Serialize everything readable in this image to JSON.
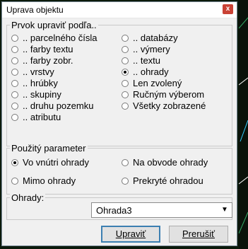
{
  "window": {
    "title": "Uprava objektu",
    "close_label": "x"
  },
  "group1": {
    "legend": "Prvok upraviť podľa..",
    "left_options": [
      ".. parcelného čísla",
      ".. farby textu",
      ".. farby zobr.",
      ".. vrstvy",
      ".. hrúbky",
      ".. skupiny",
      ".. druhu pozemku",
      ".. atributu"
    ],
    "right_options": [
      ".. databázy",
      ".. výmery",
      ".. textu",
      ".. ohrady",
      "Len zvolený",
      "Ručným výberom",
      "Všetky zobrazené"
    ],
    "selected": ".. ohrady"
  },
  "group2": {
    "legend": "Použitý parameter",
    "options": [
      "Vo vnútri ohrady",
      "Na obvode ohrady",
      "Mimo ohrady",
      "Prekryté ohradou"
    ],
    "selected": "Vo vnútri ohrady"
  },
  "group3": {
    "legend": "Ohrady:",
    "combo_value": "Ohrada3"
  },
  "buttons": {
    "ok": "Upraviť",
    "cancel": "Prerušiť"
  }
}
